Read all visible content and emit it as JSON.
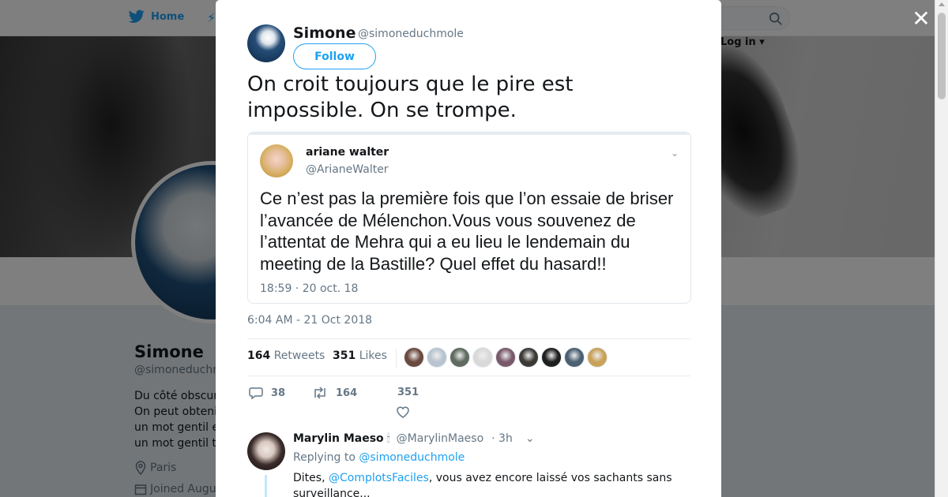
{
  "nav": {
    "home_label": "Home",
    "login_label": "Log in"
  },
  "profile": {
    "name": "Simone",
    "handle": "@simoneduchmole",
    "bio_lines": [
      "Du côté obscur",
      "On peut obteni",
      "un mot gentil e",
      "un mot gentil t"
    ],
    "location": "Paris",
    "joined": "Joined Augu"
  },
  "modal": {
    "close_label": "✕",
    "author": {
      "name": "Simone",
      "handle": "@simoneduchmole",
      "follow_label": "Follow"
    },
    "tweet_text": "On croit toujours que le pire est impossible. On se trompe.",
    "quoted": {
      "name": "ariane walter",
      "handle": "@ArianeWalter",
      "text": "Ce n’est pas la première fois que l’on essaie de briser l’avancée de Mélenchon.Vous vous souvenez de l’attentat de Mehra qui a eu lieu le lendemain du meeting de la Bastille? Quel effet du hasard!!",
      "time": "18:59 · 20 oct. 18"
    },
    "timestamp": "6:04 AM - 21 Oct 2018",
    "stats": {
      "retweets_count": "164",
      "retweets_label": "Retweets",
      "likes_count": "351",
      "likes_label": "Likes"
    },
    "actions": {
      "reply_count": "38",
      "retweet_count": "164",
      "like_count": "351"
    },
    "reply": {
      "name": "Marylin Maeso",
      "candle": "🕯",
      "handle": "@MarylinMaeso",
      "time": "· 3h",
      "replying_prefix": "Replying to",
      "replying_handle": "@simoneduchmole",
      "text_prefix": "Dites,",
      "text_mention": "@ComplotsFaciles",
      "text_rest": ", vous avez encore laissé vos sachants sans surveillance..."
    }
  },
  "colors": {
    "accent": "#1da1f2",
    "text_primary": "#14171a",
    "text_secondary": "#657786",
    "border": "#e6ecf0"
  },
  "likers_colors": [
    "#6b4a3e",
    "#b8c4cf",
    "#5f6b5e",
    "#d9d9d9",
    "#7a5a6a",
    "#3d3a35",
    "#1f1f1f",
    "#4b6072",
    "#c9a25a"
  ]
}
